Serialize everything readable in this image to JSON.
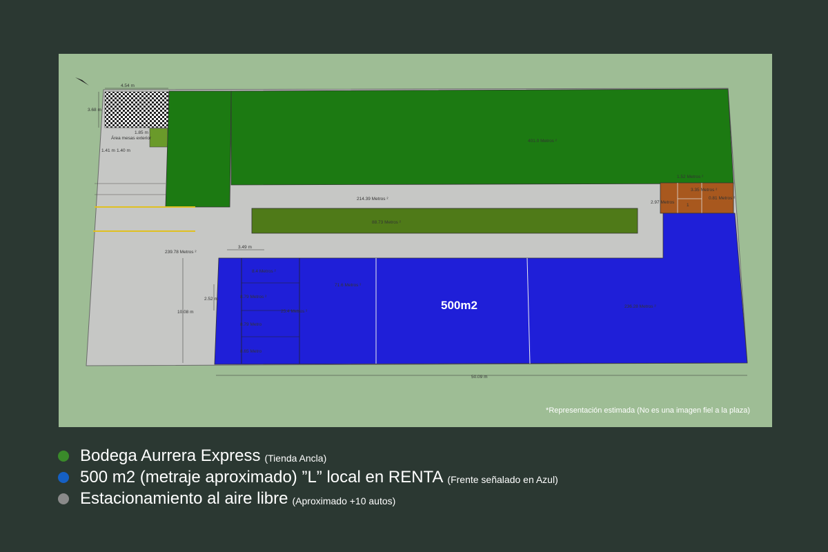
{
  "plan": {
    "background_color": "#9ebd95",
    "labels": {
      "width_top": "4.54 m",
      "height_left": "3.68 m",
      "w185": "1.85 m",
      "area_mesas": "Área mesas exterior",
      "d141": "1.41 m",
      "d140": "1.40 m",
      "store_area": "401.0 Metros ²",
      "parking_center": "214.39 Metros ²",
      "garden_center": "88.73 Metros ²",
      "parking_left": "239.78 Metros ²",
      "d349": "3.49 m",
      "d252": "2.52 m",
      "d1008": "10.08 m",
      "r_a": "8.4 Metros ²",
      "r_b": "8.79 Metros ²",
      "r_c": "8.79 Metro",
      "r_d": "8.65 Metro",
      "area_254": "25.4 Metros ²",
      "area_716": "71.6 Metros ²",
      "big_label": "500m2",
      "area_right": "236.28 Metros ²",
      "total_width": "50.09 m",
      "br_a": "1.52 Metros ²",
      "br_b": "3.35 Metros ²",
      "br_c": "2.97 Metros",
      "br_d": "0.81 Metros ²",
      "br_e": "1"
    },
    "note": "*Representación estimada (No es una imagen fiel a la plaza)"
  },
  "legend": [
    {
      "color": "#3a8a2a",
      "label": "Bodega Aurrera Express",
      "sub": "(Tienda Ancla)"
    },
    {
      "color": "#1560c4",
      "label": "500 m2 (metraje aproximado) ”L” local en RENTA",
      "sub": "(Frente señalado en Azul)"
    },
    {
      "color": "#8a8a8a",
      "label": "Estacionamiento al aire libre",
      "sub": "(Aproximado +10 autos)"
    }
  ]
}
